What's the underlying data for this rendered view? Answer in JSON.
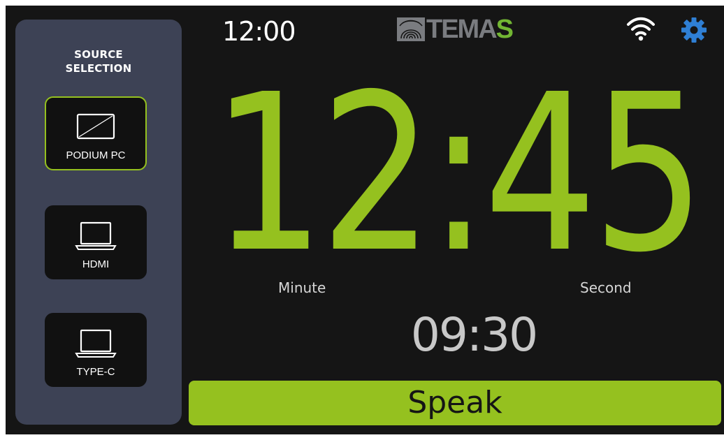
{
  "sidebar": {
    "title_line1": "SOURCE",
    "title_line2": "SELECTION",
    "sources": [
      {
        "label": "PODIUM PC",
        "icon": "monitor-icon",
        "selected": true
      },
      {
        "label": "HDMI",
        "icon": "laptop-icon",
        "selected": false
      },
      {
        "label": "TYPE-C",
        "icon": "laptop-icon",
        "selected": false
      }
    ]
  },
  "header": {
    "clock": "12:00",
    "logo_main": "TEMA",
    "logo_accent": "S",
    "wifi_icon": "wifi-icon",
    "settings_icon": "gear-icon"
  },
  "timer": {
    "main": "12:45",
    "minute_label": "Minute",
    "second_label": "Second",
    "secondary": "09:30"
  },
  "status": {
    "label": "Speak"
  },
  "colors": {
    "accent": "#95c11f",
    "sidebar": "#3d4255",
    "background": "#151515",
    "settings": "#2f7fd4"
  }
}
